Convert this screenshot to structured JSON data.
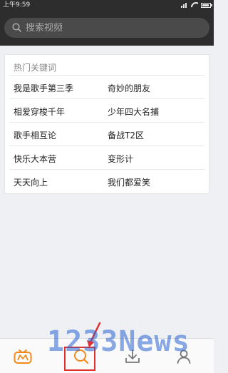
{
  "status_bar": {
    "time": "上午9:59"
  },
  "search": {
    "placeholder": "搜索视频"
  },
  "hot_keywords": {
    "title": "热门关键词",
    "rows": [
      {
        "left": "我是歌手第三季",
        "right": "奇妙的朋友"
      },
      {
        "left": "相爱穿梭千年",
        "right": "少年四大名捕"
      },
      {
        "left": "歌手相互论",
        "right": "备战T2区"
      },
      {
        "left": "快乐大本营",
        "right": "变形计"
      },
      {
        "left": "天天向上",
        "right": "我们都爱笑"
      }
    ]
  },
  "bottom_nav": {
    "items": [
      {
        "icon": "mango-tv-logo-icon",
        "active": false
      },
      {
        "icon": "search-icon",
        "active": true
      },
      {
        "icon": "download-icon",
        "active": false
      },
      {
        "icon": "profile-icon",
        "active": false
      }
    ]
  },
  "watermark": {
    "text": "1233News"
  },
  "colors": {
    "header_bg": "#2d2d2d",
    "search_box_bg": "#4a4a4a",
    "accent_orange": "#f28a1e",
    "highlight_red": "#e03030",
    "watermark_blue": "#2864d2"
  }
}
